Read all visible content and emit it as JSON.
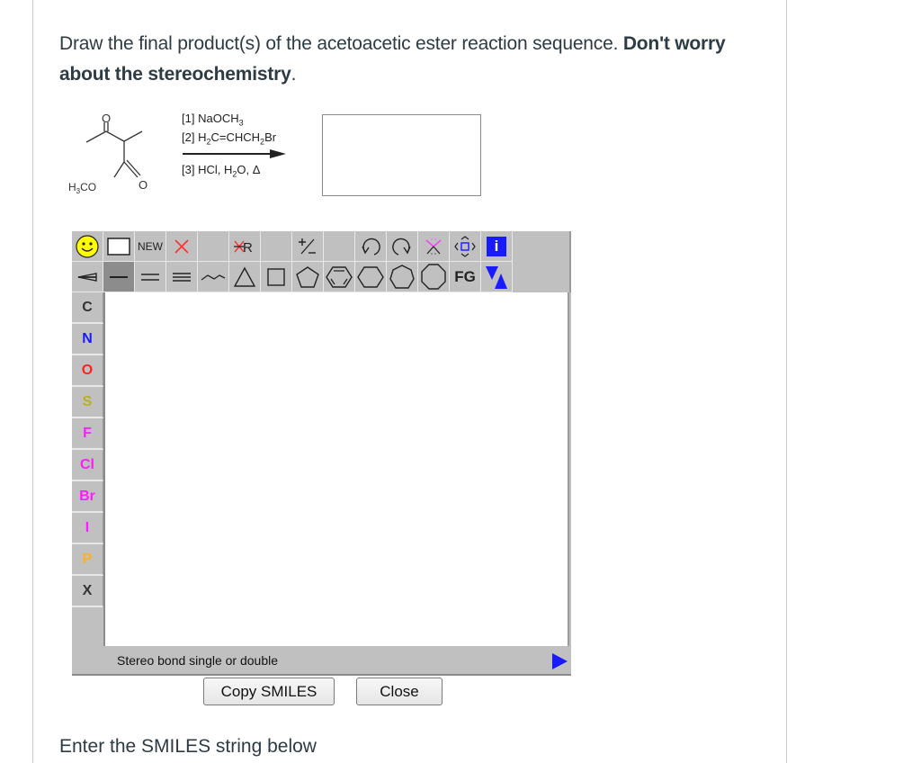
{
  "question": {
    "text_regular": "Draw the final product(s) of the acetoacetic ester reaction sequence. ",
    "text_bold": "Don't worry about the stereochemistry",
    "text_end": "."
  },
  "reaction": {
    "starting_material": {
      "carbonyl_oxygen_label": "O",
      "ester_oxygen_label": "O",
      "methoxy_label": "H3CO"
    },
    "reagents": [
      {
        "step": "[1]",
        "text": "NaOCH",
        "sub": "3",
        "after": ""
      },
      {
        "step": "[2]",
        "text": "H",
        "sub": "2",
        "after": "C=CHCH",
        "sub2": "2",
        "after2": "Br"
      },
      {
        "step": "[3]",
        "text": "HCl, H",
        "sub": "2",
        "after": "O, Δ"
      }
    ],
    "product_box": ""
  },
  "editor": {
    "toolbar_row1": [
      {
        "name": "smiley-icon",
        "label": ""
      },
      {
        "name": "blank-rectangle-icon",
        "label": ""
      },
      {
        "name": "new-button",
        "label": "NEW"
      },
      {
        "name": "delete-x-icon",
        "label": ""
      },
      {
        "name": "empty-slot",
        "label": ""
      },
      {
        "name": "remove-r-group-icon",
        "label": "R"
      },
      {
        "name": "empty-slot",
        "label": ""
      },
      {
        "name": "charge-plus-minus-icon",
        "label": ""
      },
      {
        "name": "empty-slot",
        "label": ""
      },
      {
        "name": "undo-icon",
        "label": ""
      },
      {
        "name": "redo-icon",
        "label": ""
      },
      {
        "name": "clear-pink-x-icon",
        "label": ""
      },
      {
        "name": "move-arrows-icon",
        "label": ""
      },
      {
        "name": "info-icon",
        "label": "i"
      }
    ],
    "toolbar_row2": [
      {
        "name": "stereo-bond-icon",
        "label": ""
      },
      {
        "name": "single-bond-icon",
        "label": "",
        "active": true
      },
      {
        "name": "double-bond-icon",
        "label": ""
      },
      {
        "name": "triple-bond-icon",
        "label": ""
      },
      {
        "name": "chain-icon",
        "label": ""
      },
      {
        "name": "triangle-ring-icon",
        "label": ""
      },
      {
        "name": "square-ring-icon",
        "label": ""
      },
      {
        "name": "pentagon-ring-icon",
        "label": ""
      },
      {
        "name": "benzene-ring-icon",
        "label": ""
      },
      {
        "name": "hexagon-ring-icon",
        "label": ""
      },
      {
        "name": "heptagon-ring-icon",
        "label": ""
      },
      {
        "name": "octagon-ring-icon",
        "label": ""
      },
      {
        "name": "functional-group-button",
        "label": "FG"
      },
      {
        "name": "template-triangles-icon",
        "label": ""
      }
    ],
    "atoms": [
      {
        "symbol": "C",
        "color": "#333333"
      },
      {
        "symbol": "N",
        "color": "#1a1aff"
      },
      {
        "symbol": "O",
        "color": "#ff2020"
      },
      {
        "symbol": "S",
        "color": "#b8b020"
      },
      {
        "symbol": "F",
        "color": "#ff1aff"
      },
      {
        "symbol": "Cl",
        "color": "#ff1aff"
      },
      {
        "symbol": "Br",
        "color": "#ff1aff"
      },
      {
        "symbol": "I",
        "color": "#ff1aff"
      },
      {
        "symbol": "P",
        "color": "#ffb020"
      },
      {
        "symbol": "X",
        "color": "#333333"
      }
    ],
    "status_text": "Stereo bond single or double"
  },
  "buttons": {
    "copy_smiles": "Copy SMILES",
    "close": "Close"
  },
  "footer_prompt": "Enter the SMILES string below"
}
